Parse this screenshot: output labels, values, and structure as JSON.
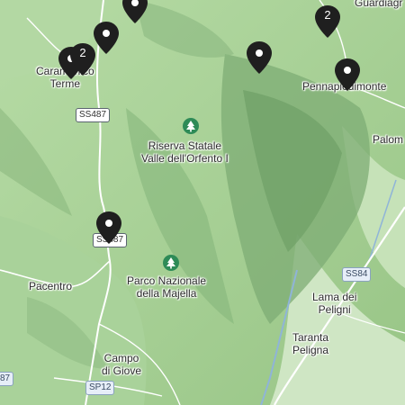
{
  "places": {
    "caramanico_1": "Caramanico",
    "caramanico_2": "Terme",
    "guardiagrele": "Guardiagr",
    "pennapiedimonte": "Pennapiedimonte",
    "palombaro": "Palom",
    "riserva_1": "Riserva Statale",
    "riserva_2": "Valle dell'Orfento I",
    "parco_1": "Parco Nazionale",
    "parco_2": "della Majella",
    "pacentro": "Pacentro",
    "lama_1": "Lama dei",
    "lama_2": "Peligni",
    "taranta_1": "Taranta",
    "taranta_2": "Peligna",
    "campo_1": "Campo",
    "campo_2": "di Giove"
  },
  "roads": {
    "ss487_north": "SS487",
    "ss487_south": "SS487",
    "ss84": "SS84",
    "sp12": "SP12",
    "edge": "87"
  },
  "pins": {
    "cluster_caramanico": "2",
    "cluster_guardiagrele": "2"
  },
  "icons": {
    "pin": "location-pin-icon",
    "park": "park-tree-icon"
  },
  "colors": {
    "pin": "#1f1f1f",
    "park_icon": "#2e8b57",
    "terrain_light": "#a9d39a",
    "terrain_dark": "#6f9f66"
  }
}
